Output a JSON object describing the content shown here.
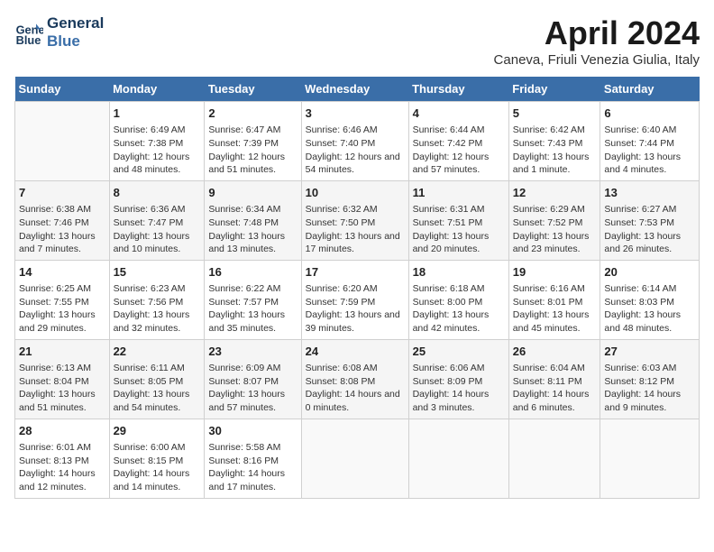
{
  "logo": {
    "line1": "General",
    "line2": "Blue"
  },
  "title": "April 2024",
  "subtitle": "Caneva, Friuli Venezia Giulia, Italy",
  "days_of_week": [
    "Sunday",
    "Monday",
    "Tuesday",
    "Wednesday",
    "Thursday",
    "Friday",
    "Saturday"
  ],
  "weeks": [
    [
      {
        "day": "",
        "sunrise": "",
        "sunset": "",
        "daylight": ""
      },
      {
        "day": "1",
        "sunrise": "Sunrise: 6:49 AM",
        "sunset": "Sunset: 7:38 PM",
        "daylight": "Daylight: 12 hours and 48 minutes."
      },
      {
        "day": "2",
        "sunrise": "Sunrise: 6:47 AM",
        "sunset": "Sunset: 7:39 PM",
        "daylight": "Daylight: 12 hours and 51 minutes."
      },
      {
        "day": "3",
        "sunrise": "Sunrise: 6:46 AM",
        "sunset": "Sunset: 7:40 PM",
        "daylight": "Daylight: 12 hours and 54 minutes."
      },
      {
        "day": "4",
        "sunrise": "Sunrise: 6:44 AM",
        "sunset": "Sunset: 7:42 PM",
        "daylight": "Daylight: 12 hours and 57 minutes."
      },
      {
        "day": "5",
        "sunrise": "Sunrise: 6:42 AM",
        "sunset": "Sunset: 7:43 PM",
        "daylight": "Daylight: 13 hours and 1 minute."
      },
      {
        "day": "6",
        "sunrise": "Sunrise: 6:40 AM",
        "sunset": "Sunset: 7:44 PM",
        "daylight": "Daylight: 13 hours and 4 minutes."
      }
    ],
    [
      {
        "day": "7",
        "sunrise": "Sunrise: 6:38 AM",
        "sunset": "Sunset: 7:46 PM",
        "daylight": "Daylight: 13 hours and 7 minutes."
      },
      {
        "day": "8",
        "sunrise": "Sunrise: 6:36 AM",
        "sunset": "Sunset: 7:47 PM",
        "daylight": "Daylight: 13 hours and 10 minutes."
      },
      {
        "day": "9",
        "sunrise": "Sunrise: 6:34 AM",
        "sunset": "Sunset: 7:48 PM",
        "daylight": "Daylight: 13 hours and 13 minutes."
      },
      {
        "day": "10",
        "sunrise": "Sunrise: 6:32 AM",
        "sunset": "Sunset: 7:50 PM",
        "daylight": "Daylight: 13 hours and 17 minutes."
      },
      {
        "day": "11",
        "sunrise": "Sunrise: 6:31 AM",
        "sunset": "Sunset: 7:51 PM",
        "daylight": "Daylight: 13 hours and 20 minutes."
      },
      {
        "day": "12",
        "sunrise": "Sunrise: 6:29 AM",
        "sunset": "Sunset: 7:52 PM",
        "daylight": "Daylight: 13 hours and 23 minutes."
      },
      {
        "day": "13",
        "sunrise": "Sunrise: 6:27 AM",
        "sunset": "Sunset: 7:53 PM",
        "daylight": "Daylight: 13 hours and 26 minutes."
      }
    ],
    [
      {
        "day": "14",
        "sunrise": "Sunrise: 6:25 AM",
        "sunset": "Sunset: 7:55 PM",
        "daylight": "Daylight: 13 hours and 29 minutes."
      },
      {
        "day": "15",
        "sunrise": "Sunrise: 6:23 AM",
        "sunset": "Sunset: 7:56 PM",
        "daylight": "Daylight: 13 hours and 32 minutes."
      },
      {
        "day": "16",
        "sunrise": "Sunrise: 6:22 AM",
        "sunset": "Sunset: 7:57 PM",
        "daylight": "Daylight: 13 hours and 35 minutes."
      },
      {
        "day": "17",
        "sunrise": "Sunrise: 6:20 AM",
        "sunset": "Sunset: 7:59 PM",
        "daylight": "Daylight: 13 hours and 39 minutes."
      },
      {
        "day": "18",
        "sunrise": "Sunrise: 6:18 AM",
        "sunset": "Sunset: 8:00 PM",
        "daylight": "Daylight: 13 hours and 42 minutes."
      },
      {
        "day": "19",
        "sunrise": "Sunrise: 6:16 AM",
        "sunset": "Sunset: 8:01 PM",
        "daylight": "Daylight: 13 hours and 45 minutes."
      },
      {
        "day": "20",
        "sunrise": "Sunrise: 6:14 AM",
        "sunset": "Sunset: 8:03 PM",
        "daylight": "Daylight: 13 hours and 48 minutes."
      }
    ],
    [
      {
        "day": "21",
        "sunrise": "Sunrise: 6:13 AM",
        "sunset": "Sunset: 8:04 PM",
        "daylight": "Daylight: 13 hours and 51 minutes."
      },
      {
        "day": "22",
        "sunrise": "Sunrise: 6:11 AM",
        "sunset": "Sunset: 8:05 PM",
        "daylight": "Daylight: 13 hours and 54 minutes."
      },
      {
        "day": "23",
        "sunrise": "Sunrise: 6:09 AM",
        "sunset": "Sunset: 8:07 PM",
        "daylight": "Daylight: 13 hours and 57 minutes."
      },
      {
        "day": "24",
        "sunrise": "Sunrise: 6:08 AM",
        "sunset": "Sunset: 8:08 PM",
        "daylight": "Daylight: 14 hours and 0 minutes."
      },
      {
        "day": "25",
        "sunrise": "Sunrise: 6:06 AM",
        "sunset": "Sunset: 8:09 PM",
        "daylight": "Daylight: 14 hours and 3 minutes."
      },
      {
        "day": "26",
        "sunrise": "Sunrise: 6:04 AM",
        "sunset": "Sunset: 8:11 PM",
        "daylight": "Daylight: 14 hours and 6 minutes."
      },
      {
        "day": "27",
        "sunrise": "Sunrise: 6:03 AM",
        "sunset": "Sunset: 8:12 PM",
        "daylight": "Daylight: 14 hours and 9 minutes."
      }
    ],
    [
      {
        "day": "28",
        "sunrise": "Sunrise: 6:01 AM",
        "sunset": "Sunset: 8:13 PM",
        "daylight": "Daylight: 14 hours and 12 minutes."
      },
      {
        "day": "29",
        "sunrise": "Sunrise: 6:00 AM",
        "sunset": "Sunset: 8:15 PM",
        "daylight": "Daylight: 14 hours and 14 minutes."
      },
      {
        "day": "30",
        "sunrise": "Sunrise: 5:58 AM",
        "sunset": "Sunset: 8:16 PM",
        "daylight": "Daylight: 14 hours and 17 minutes."
      },
      {
        "day": "",
        "sunrise": "",
        "sunset": "",
        "daylight": ""
      },
      {
        "day": "",
        "sunrise": "",
        "sunset": "",
        "daylight": ""
      },
      {
        "day": "",
        "sunrise": "",
        "sunset": "",
        "daylight": ""
      },
      {
        "day": "",
        "sunrise": "",
        "sunset": "",
        "daylight": ""
      }
    ]
  ]
}
